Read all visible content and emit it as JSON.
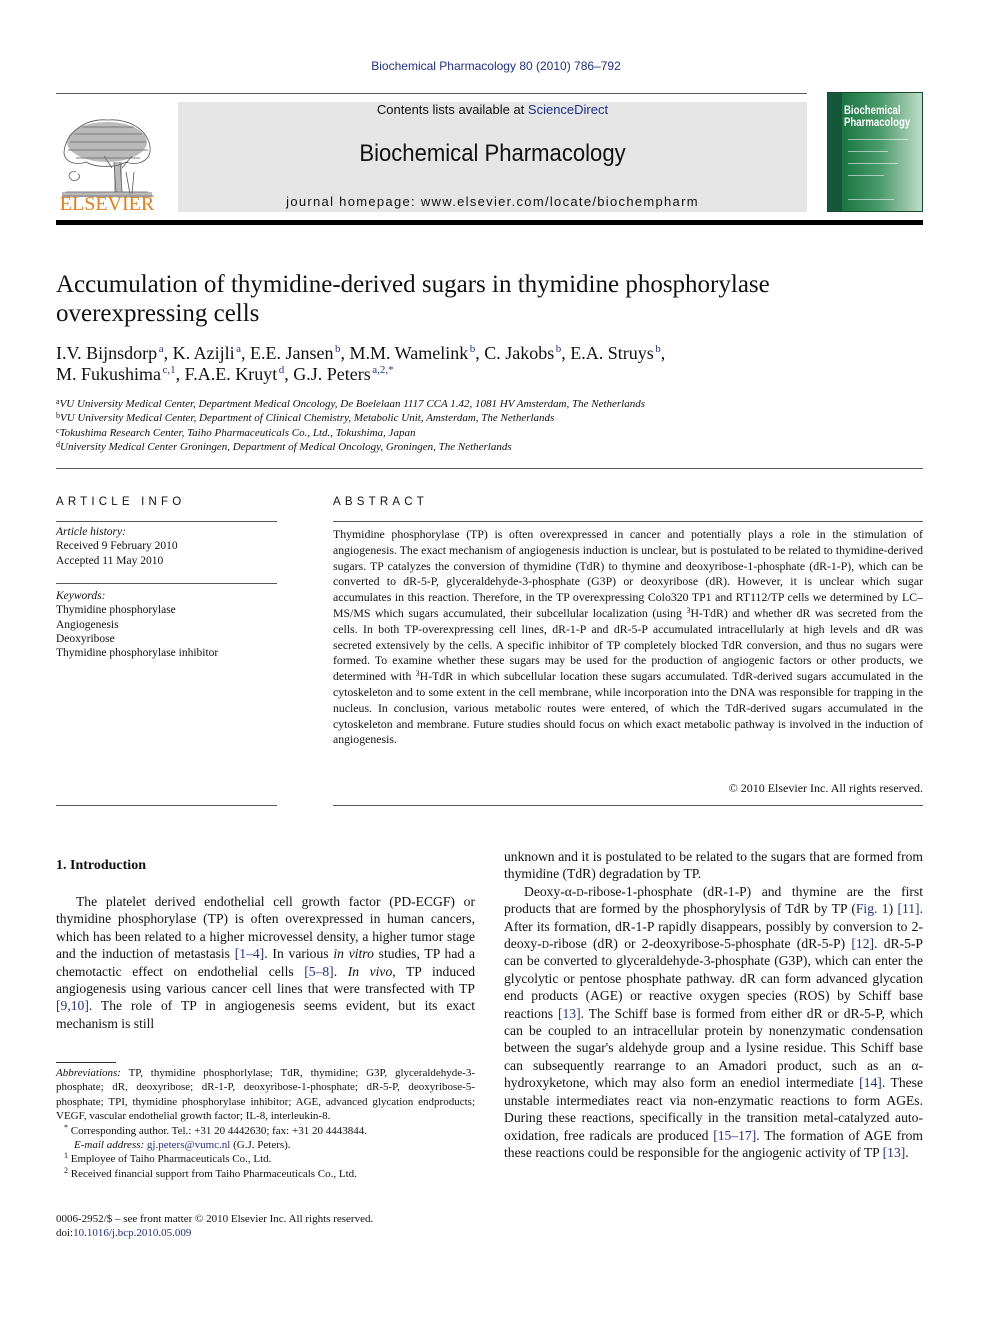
{
  "running_header": "Biochemical Pharmacology 80 (2010) 786–792",
  "masthead": {
    "publisher_logo_text": "ELSEVIER",
    "contents_prefix": "Contents lists available at ",
    "contents_link": "ScienceDirect",
    "journal_title": "Biochemical Pharmacology",
    "homepage_prefix": "journal homepage: ",
    "homepage_url": "www.elsevier.com/locate/biochempharm",
    "cover": {
      "title_line1": "Biochemical",
      "title_line2": "Pharmacology",
      "color": "#1e7a46"
    }
  },
  "article": {
    "title": "Accumulation of thymidine-derived sugars in thymidine phosphorylase overexpressing cells",
    "authors": [
      {
        "name": "I.V. Bijnsdorp",
        "sup": "a",
        "sep": ", "
      },
      {
        "name": "K. Azijli",
        "sup": "a",
        "sep": ", "
      },
      {
        "name": "E.E. Jansen",
        "sup": "b",
        "sep": ", "
      },
      {
        "name": "M.M. Wamelink",
        "sup": "b",
        "sep": ", "
      },
      {
        "name": "C. Jakobs",
        "sup": "b",
        "sep": ", "
      },
      {
        "name": "E.A. Struys",
        "sup": "b",
        "sep": ","
      },
      {
        "name": "M. Fukushima",
        "sup": "c,1",
        "sep": ", "
      },
      {
        "name": "F.A.E. Kruyt",
        "sup": "d",
        "sep": ", "
      },
      {
        "name": "G.J. Peters",
        "sup": "a,2,*",
        "sep": ""
      }
    ],
    "affiliations": [
      {
        "key": "a",
        "text": "VU University Medical Center, Department Medical Oncology, De Boelelaan 1117 CCA 1.42, 1081 HV Amsterdam, The Netherlands"
      },
      {
        "key": "b",
        "text": "VU University Medical Center, Department of Clinical Chemistry, Metabolic Unit, Amsterdam, The Netherlands"
      },
      {
        "key": "c",
        "text": "Tokushima Research Center, Taiho Pharmaceuticals Co., Ltd., Tokushima, Japan"
      },
      {
        "key": "d",
        "text": "University Medical Center Groningen, Department of Medical Oncology, Groningen, The Netherlands"
      }
    ]
  },
  "article_info": {
    "heading": "ARTICLE INFO",
    "history_label": "Article history:",
    "received": "Received 9 February 2010",
    "accepted": "Accepted 11 May 2010",
    "keywords_label": "Keywords:",
    "keywords": [
      "Thymidine phosphorylase",
      "Angiogenesis",
      "Deoxyribose",
      "Thymidine phosphorylase inhibitor"
    ]
  },
  "abstract": {
    "heading": "ABSTRACT",
    "part1": "Thymidine phosphorylase (TP) is often overexpressed in cancer and potentially plays a role in the stimulation of angiogenesis. The exact mechanism of angiogenesis induction is unclear, but is postulated to be related to thymidine-derived sugars. TP catalyzes the conversion of thymidine (TdR) to thymine and deoxyribose-1-phosphate (dR-1-P), which can be converted to dR-5-P, glyceraldehyde-3-phosphate (G3P) or deoxyribose (dR). However, it is unclear which sugar accumulates in this reaction. Therefore, in the TP overexpressing Colo320 TP1 and RT112/TP cells we determined by LC–MS/MS which sugars accumulated, their subcellular localization (using ",
    "sup1": "3",
    "part2": "H-TdR) and whether dR was secreted from the cells. In both TP-overexpressing cell lines, dR-1-P and dR-5-P accumulated intracellularly at high levels and dR was secreted extensively by the cells. A specific inhibitor of TP completely blocked TdR conversion, and thus no sugars were formed. To examine whether these sugars may be used for the production of angiogenic factors or other products, we determined with ",
    "sup2": "3",
    "part3": "H-TdR in which subcellular location these sugars accumulated. TdR-derived sugars accumulated in the cytoskeleton and to some extent in the cell membrane, while incorporation into the DNA was responsible for trapping in the nucleus. In conclusion, various metabolic routes were entered, of which the TdR-derived sugars accumulated in the cytoskeleton and membrane. Future studies should focus on which exact metabolic pathway is involved in the induction of angiogenesis.",
    "copyright": "© 2010 Elsevier Inc. All rights reserved."
  },
  "introduction": {
    "heading": "1.  Introduction",
    "left_p1": {
      "t1": "The platelet derived endothelial cell growth factor (PD-ECGF) or thymidine phosphorylase (TP) is often overexpressed in human cancers, which has been related to a higher microvessel density, a higher tumor stage and the induction of metastasis ",
      "ref1": "[1–4]",
      "t2": ". In various ",
      "it1": "in vitro",
      "t3": " studies, TP had a chemotactic effect on endothelial cells ",
      "ref2": "[5–8]",
      "t4": ". ",
      "it2": "In vivo",
      "t5": ", TP induced angiogenesis using various cancer cell lines that were transfected with TP ",
      "ref3": "[9,10]",
      "t6": ". The role of TP in angiogenesis seems evident, but its exact mechanism is still"
    },
    "right_p1": "unknown and it is postulated to be related to the sugars that are formed from thymidine (TdR) degradation by TP.",
    "right_p2": {
      "t1": "Deoxy-α-",
      "sc1": "d",
      "t2": "-ribose-1-phosphate (dR-1-P) and thymine are the first products that are formed by the phosphorylysis of TdR by TP (",
      "fig": "Fig. 1",
      "t3": ") ",
      "ref1": "[11]",
      "t4": ". After its formation, dR-1-P rapidly disappears, possibly by conversion to 2-deoxy-",
      "sc2": "d",
      "t5": "-ribose (dR) or 2-deoxyribose-5-phosphate (dR-5-P) ",
      "ref2": "[12]",
      "t6": ". dR-5-P can be converted to glyceraldehyde-3-phosphate (G3P), which can enter the glycolytic or pentose phosphate pathway. dR can form advanced glycation end products (AGE) or reactive oxygen species (ROS) by Schiff base reactions ",
      "ref3": "[13]",
      "t7": ". The Schiff base is formed from either dR or dR-5-P, which can be coupled to an intracellular protein by nonenzymatic condensation between the sugar's aldehyde group and a lysine residue. This Schiff base can subsequently rearrange to an Amadori product, such as an α-hydroxyketone, which may also form an enediol intermediate ",
      "ref4": "[14]",
      "t8": ". These unstable intermediates react via non-enzymatic reactions to form AGEs. During these reactions, specifically in the transition metal-catalyzed auto-oxidation, free radicals are produced ",
      "ref5": "[15–17]",
      "t9": ". The formation of AGE from these reactions could be responsible for the angiogenic activity of TP ",
      "ref6": "[13]",
      "t10": "."
    }
  },
  "footnotes": {
    "abbrev_label": "Abbreviations:",
    "abbrev_text": " TP, thymidine phosphorlylase; TdR, thymidine; G3P, glyceraldehyde-3-phosphate; dR, deoxyribose; dR-1-P, deoxyribose-1-phosphate; dR-5-P, deoxyribose-5-phosphate; TPI, thymidine phosphorylase inhibitor; AGE, advanced glycation endproducts; VEGF, vascular endothelial growth factor; IL-8, interleukin-8.",
    "corresponding_mark": "*",
    "corresponding": " Corresponding author. Tel.: +31 20 4442630; fax: +31 20 4443844.",
    "email_label": "E-mail address:",
    "email": "gj.peters@vumc.nl",
    "email_suffix": " (G.J. Peters).",
    "fn1_mark": "1",
    "fn1": " Employee of Taiho Pharmaceuticals Co., Ltd.",
    "fn2_mark": "2",
    "fn2": " Received financial support from Taiho Pharmaceuticals Co., Ltd."
  },
  "front_matter": {
    "issn_line": "0006-2952/$ – see front matter © 2010 Elsevier Inc. All rights reserved.",
    "doi_prefix": "doi:",
    "doi": "10.1016/j.bcp.2010.05.009"
  }
}
